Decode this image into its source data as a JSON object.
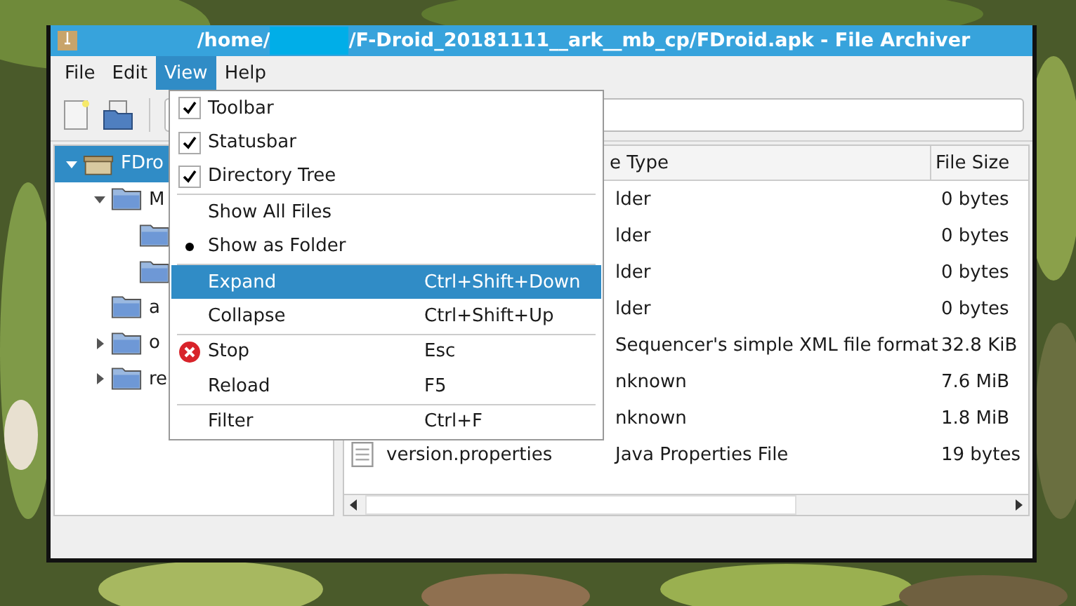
{
  "window": {
    "title_start": "/home/",
    "title_end": "/F-Droid_20181111__ark__mb_cp/FDroid.apk - File Archiver"
  },
  "menubar": [
    {
      "label": "File",
      "selected": false
    },
    {
      "label": "Edit",
      "selected": false
    },
    {
      "label": "View",
      "selected": true
    },
    {
      "label": "Help",
      "selected": false
    }
  ],
  "tree": [
    {
      "label": "FDro",
      "selected": true,
      "expanded": true,
      "children": [
        {
          "label": "M",
          "selected": false,
          "expanded": true,
          "children": [
            {
              "selected": false
            },
            {
              "selected": false
            }
          ]
        },
        {
          "label": "a",
          "selected": false
        },
        {
          "label": "o",
          "selected": false,
          "expanded": false
        },
        {
          "label": "re",
          "selected": false,
          "expanded": false
        }
      ]
    }
  ],
  "table": {
    "columns": [
      "e Type",
      "File Size"
    ],
    "rows": [
      {
        "type": "lder",
        "size": "0 bytes"
      },
      {
        "type": "lder",
        "size": "0 bytes"
      },
      {
        "type": "lder",
        "size": "0 bytes"
      },
      {
        "type": "lder",
        "size": "0 bytes"
      },
      {
        "type": "Sequencer's simple XML file format",
        "size": "32.8  KiB"
      },
      {
        "type": "nknown",
        "size": "7.6  MiB"
      },
      {
        "type": "nknown",
        "size": "1.8  MiB"
      },
      {
        "name": "version.properties",
        "type": "Java Properties File",
        "size": "19 bytes"
      }
    ]
  },
  "view_menu": [
    {
      "kind": "check",
      "label": "Toolbar",
      "checked": true,
      "selected": false
    },
    {
      "kind": "check",
      "label": "Statusbar",
      "checked": true,
      "selected": false
    },
    {
      "kind": "check",
      "label": "Directory Tree",
      "checked": true,
      "selected": false
    },
    {
      "kind": "separator"
    },
    {
      "kind": "check",
      "label": "Show All Files",
      "checked": false,
      "selected": false
    },
    {
      "kind": "radio",
      "label": "Show as Folder",
      "checked": true,
      "selected": false
    },
    {
      "kind": "separator"
    },
    {
      "kind": "command",
      "label": "Expand",
      "shortcut": "Ctrl+Shift+Down",
      "selected": true
    },
    {
      "kind": "command",
      "label": "Collapse",
      "shortcut": "Ctrl+Shift+Up",
      "selected": false
    },
    {
      "kind": "separator"
    },
    {
      "kind": "stop",
      "label": "Stop",
      "shortcut": "Esc",
      "selected": false
    },
    {
      "kind": "command",
      "label": "Reload",
      "shortcut": "F5",
      "selected": false
    },
    {
      "kind": "separator"
    },
    {
      "kind": "command",
      "label": "Filter",
      "shortcut": "Ctrl+F",
      "selected": false
    }
  ]
}
